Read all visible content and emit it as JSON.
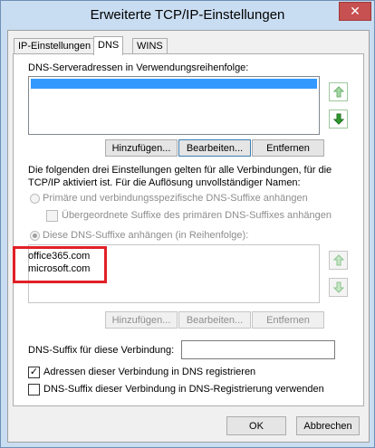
{
  "window": {
    "title": "Erweiterte TCP/IP-Einstellungen",
    "close_glyph": "✕"
  },
  "tabs": [
    {
      "label": "IP-Einstellungen",
      "active": false
    },
    {
      "label": "DNS",
      "active": true
    },
    {
      "label": "WINS",
      "active": false
    }
  ],
  "dns": {
    "server_label": "DNS-Serveradressen in Verwendungsreihenfolge:",
    "server_buttons": {
      "add": "Hinzufügen...",
      "edit": "Bearbeiten...",
      "remove": "Entfernen"
    },
    "info_line1": "Die folgenden drei Einstellungen gelten für alle Verbindungen, für die",
    "info_line2": "TCP/IP aktiviert ist. Für die Auflösung unvollständiger Namen:",
    "radio_primary": "Primäre und verbindungsspezifische DNS-Suffixe anhängen",
    "check_parent": "Übergeordnete Suffixe des primären DNS-Suffixes anhängen",
    "radio_these": "Diese DNS-Suffixe anhängen (in Reihenfolge):",
    "suffixes": [
      "office365.com",
      "microsoft.com"
    ],
    "suffix_buttons": {
      "add": "Hinzufügen...",
      "edit": "Bearbeiten...",
      "remove": "Entfernen"
    },
    "conn_suffix_label": "DNS-Suffix für diese Verbindung:",
    "conn_suffix_value": "",
    "register_label": "Adressen dieser Verbindung in DNS registrieren",
    "register_checked": true,
    "use_suffix_label": "DNS-Suffix dieser Verbindung in DNS-Registrierung verwenden",
    "use_suffix_checked": false
  },
  "footer": {
    "ok": "OK",
    "cancel": "Abbrechen"
  },
  "icons": {
    "up": "arrow-up-icon",
    "down": "arrow-down-icon"
  },
  "colors": {
    "highlight": "#e21f26",
    "selection": "#3399ff",
    "arrow_green": "#2e9a2e"
  }
}
